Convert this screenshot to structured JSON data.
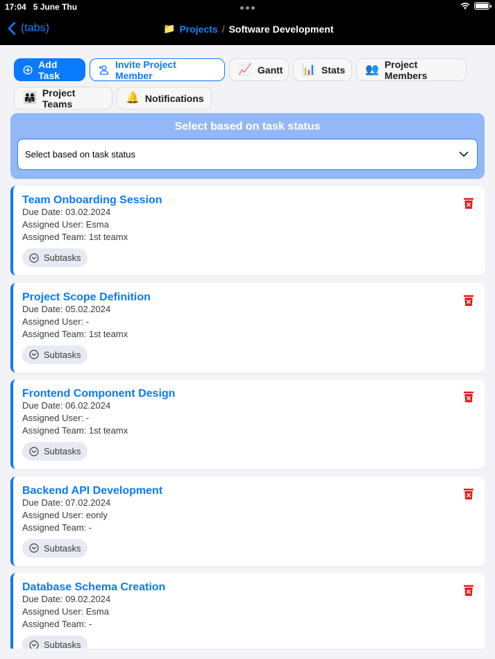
{
  "status_bar": {
    "time": "17:04",
    "date": "5 June Thu"
  },
  "nav": {
    "back_label": "(tabs)",
    "folder_icon": "📁",
    "breadcrumb_link": "Projects",
    "breadcrumb_sep": "/",
    "breadcrumb_current": "Software Development"
  },
  "actions": {
    "add_task": "Add Task",
    "invite_member": "Invite Project Member",
    "gantt": "Gantt",
    "gantt_icon": "📈",
    "stats": "Stats",
    "stats_icon": "📊",
    "project_members": "Project Members",
    "members_icon": "👥",
    "project_teams": "Project Teams",
    "teams_icon": "👨‍👩‍👧",
    "notifications": "Notifications",
    "notifications_icon": "🔔"
  },
  "filter": {
    "title": "Select based on task status",
    "selected": "Select based on task status"
  },
  "tasks": [
    {
      "title": "Team Onboarding Session",
      "due": "Due Date: 03.02.2024",
      "user": "Assigned User: Esma",
      "team": "Assigned Team: 1st teamx",
      "subtasks": "Subtasks"
    },
    {
      "title": "Project Scope Definition",
      "due": "Due Date: 05.02.2024",
      "user": "Assigned User: -",
      "team": "Assigned Team: 1st teamx",
      "subtasks": "Subtasks"
    },
    {
      "title": "Frontend Component Design",
      "due": "Due Date: 06.02.2024",
      "user": "Assigned User: -",
      "team": "Assigned Team: 1st teamx",
      "subtasks": "Subtasks"
    },
    {
      "title": "Backend API Development",
      "due": "Due Date: 07.02.2024",
      "user": "Assigned User: eonly",
      "team": "Assigned Team: -",
      "subtasks": "Subtasks"
    },
    {
      "title": "Database Schema Creation",
      "due": "Due Date: 09.02.2024",
      "user": "Assigned User: Esma",
      "team": "Assigned Team: -",
      "subtasks": "Subtasks"
    }
  ],
  "colors": {
    "accent": "#0a7aff",
    "filter_panel": "#93b8f7",
    "delete": "#e0201b"
  }
}
